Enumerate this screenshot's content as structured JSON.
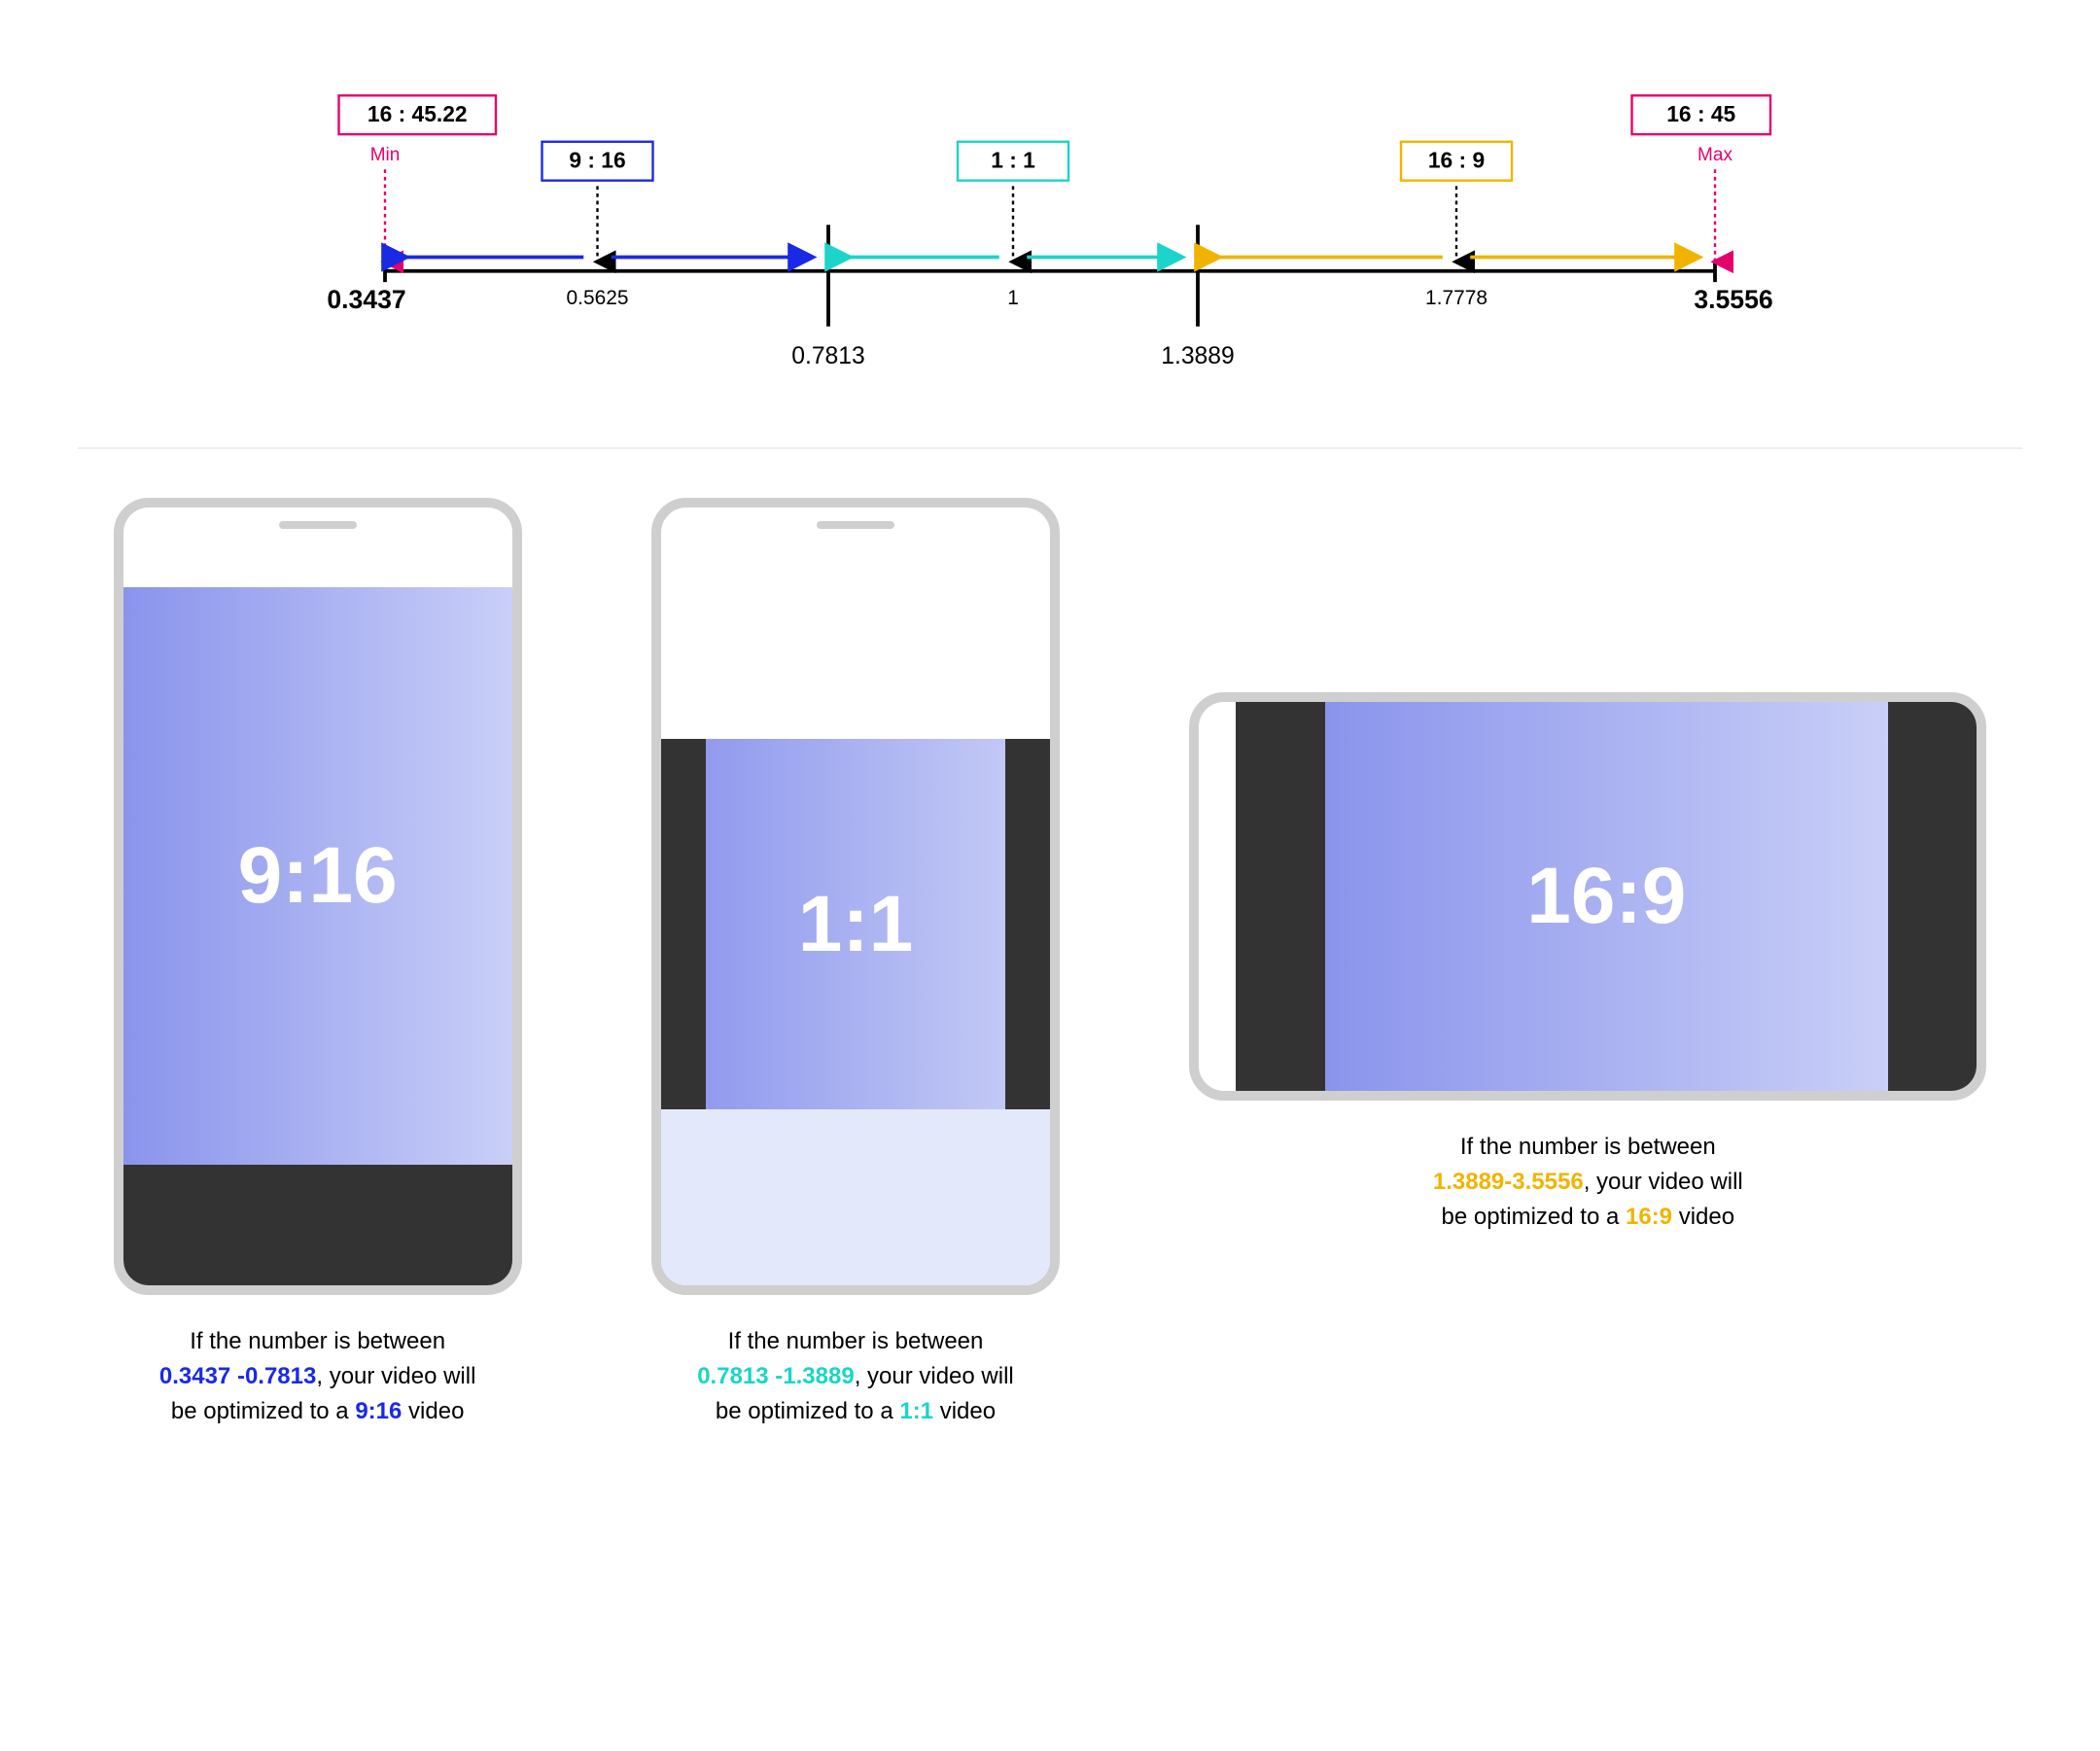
{
  "timeline": {
    "min_box": "16 : 45.22",
    "min_label": "Min",
    "min_value": "0.3437",
    "max_box": "16 : 45",
    "max_label": "Max",
    "max_value": "3.5556",
    "ratios": {
      "r916": {
        "label": "9 : 16",
        "value": "0.5625"
      },
      "r11": {
        "label": "1 : 1",
        "value": "1"
      },
      "r169": {
        "label": "16 : 9",
        "value": "1.7778"
      }
    },
    "breaks": {
      "b1": "0.7813",
      "b2": "1.3889"
    }
  },
  "phones": {
    "p916": {
      "ratio": "9:16",
      "text1": "If the number is between",
      "range": "0.3437 -0.7813",
      "text2": ", your video will",
      "text3": "be optimized to a ",
      "ratio_bold": "9:16",
      "text4": " video"
    },
    "p11": {
      "ratio": "1:1",
      "text1": "If the number is between",
      "range": "0.7813 -1.3889",
      "text2": ", your video will",
      "text3": "be optimized to a ",
      "ratio_bold": "1:1",
      "text4": " video"
    },
    "p169": {
      "ratio": "16:9",
      "text1": "If the number is between",
      "range": "1.3889-3.5556",
      "text2": ", your video will",
      "text3": "be optimized to a ",
      "ratio_bold": "16:9",
      "text4": " video"
    }
  },
  "chart_data": {
    "type": "number-line",
    "axis": {
      "min": 0.3437,
      "max": 3.5556
    },
    "endpoints": [
      {
        "name": "Min",
        "value": 0.3437,
        "label": "16 : 45.22"
      },
      {
        "name": "Max",
        "value": 3.5556,
        "label": "16 : 45"
      }
    ],
    "markers": [
      {
        "name": "9 : 16",
        "value": 0.5625,
        "color": "#1a29e6"
      },
      {
        "name": "1 : 1",
        "value": 1.0,
        "color": "#1cd4c9"
      },
      {
        "name": "16 : 9",
        "value": 1.7778,
        "color": "#f0b400"
      }
    ],
    "breakpoints": [
      0.7813,
      1.3889
    ],
    "ranges": [
      {
        "name": "9:16",
        "from": 0.3437,
        "to": 0.7813,
        "color": "#1a29e6"
      },
      {
        "name": "1:1",
        "from": 0.7813,
        "to": 1.3889,
        "color": "#1cd4c9"
      },
      {
        "name": "16:9",
        "from": 1.3889,
        "to": 3.5556,
        "color": "#f0b400"
      }
    ]
  }
}
